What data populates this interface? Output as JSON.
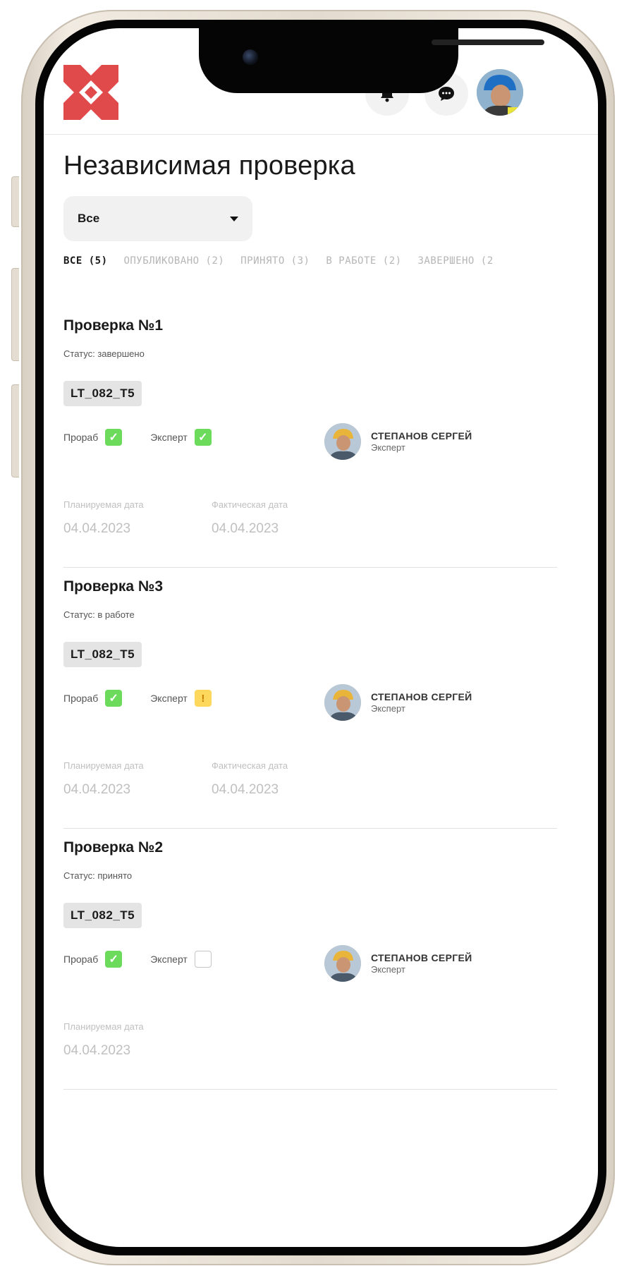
{
  "header": {
    "logo_icon": "brand-logo-icon",
    "brand_color": "#e04a4a",
    "notification_icon": "bell-icon",
    "chat_icon": "chat-bubble-icon",
    "profile_icon": "user-avatar"
  },
  "page": {
    "title": "Независимая проверка"
  },
  "filter": {
    "selected": "Все",
    "icon": "caret-down-icon"
  },
  "tabs": [
    {
      "label": "ВСЕ (5)",
      "active": true
    },
    {
      "label": "ОПУБЛИКОВАНО (2)",
      "active": false
    },
    {
      "label": "ПРИНЯТО (3)",
      "active": false
    },
    {
      "label": "В РАБОТЕ (2)",
      "active": false
    },
    {
      "label": "ЗАВЕРШЕНО (2",
      "active": false
    }
  ],
  "cards": [
    {
      "title": "Проверка №1",
      "status": "Статус: завершено",
      "code": "LT_082_T5",
      "foreman_label": "Прораб",
      "foreman_state": "checked",
      "expert_label": "Эксперт",
      "expert_state": "checked",
      "person_name": "СТЕПАНОВ СЕРГЕЙ",
      "person_role": "Эксперт",
      "planned_label": "Планируемая дата",
      "planned_date": "04.04.2023",
      "actual_label": "Фактическая дата",
      "actual_date": "04.04.2023"
    },
    {
      "title": "Проверка №3",
      "status": "Статус: в работе",
      "code": "LT_082_T5",
      "foreman_label": "Прораб",
      "foreman_state": "checked",
      "expert_label": "Эксперт",
      "expert_state": "warning",
      "expert_mark": "!",
      "person_name": "СТЕПАНОВ СЕРГЕЙ",
      "person_role": "Эксперт",
      "planned_label": "Планируемая дата",
      "planned_date": "04.04.2023",
      "actual_label": "Фактическая дата",
      "actual_date": "04.04.2023"
    },
    {
      "title": "Проверка №2",
      "status": "Статус: принято",
      "code": "LT_082_T5",
      "foreman_label": "Прораб",
      "foreman_state": "checked",
      "expert_label": "Эксперт",
      "expert_state": "unchecked",
      "person_name": "СТЕПАНОВ СЕРГЕЙ",
      "person_role": "Эксперт",
      "planned_label": "Планируемая дата",
      "planned_date": "04.04.2023"
    }
  ],
  "colors": {
    "check_ok": "#6cdb5c",
    "check_warning": "#fdd85c",
    "tab_inactive": "#b6b6b6"
  }
}
